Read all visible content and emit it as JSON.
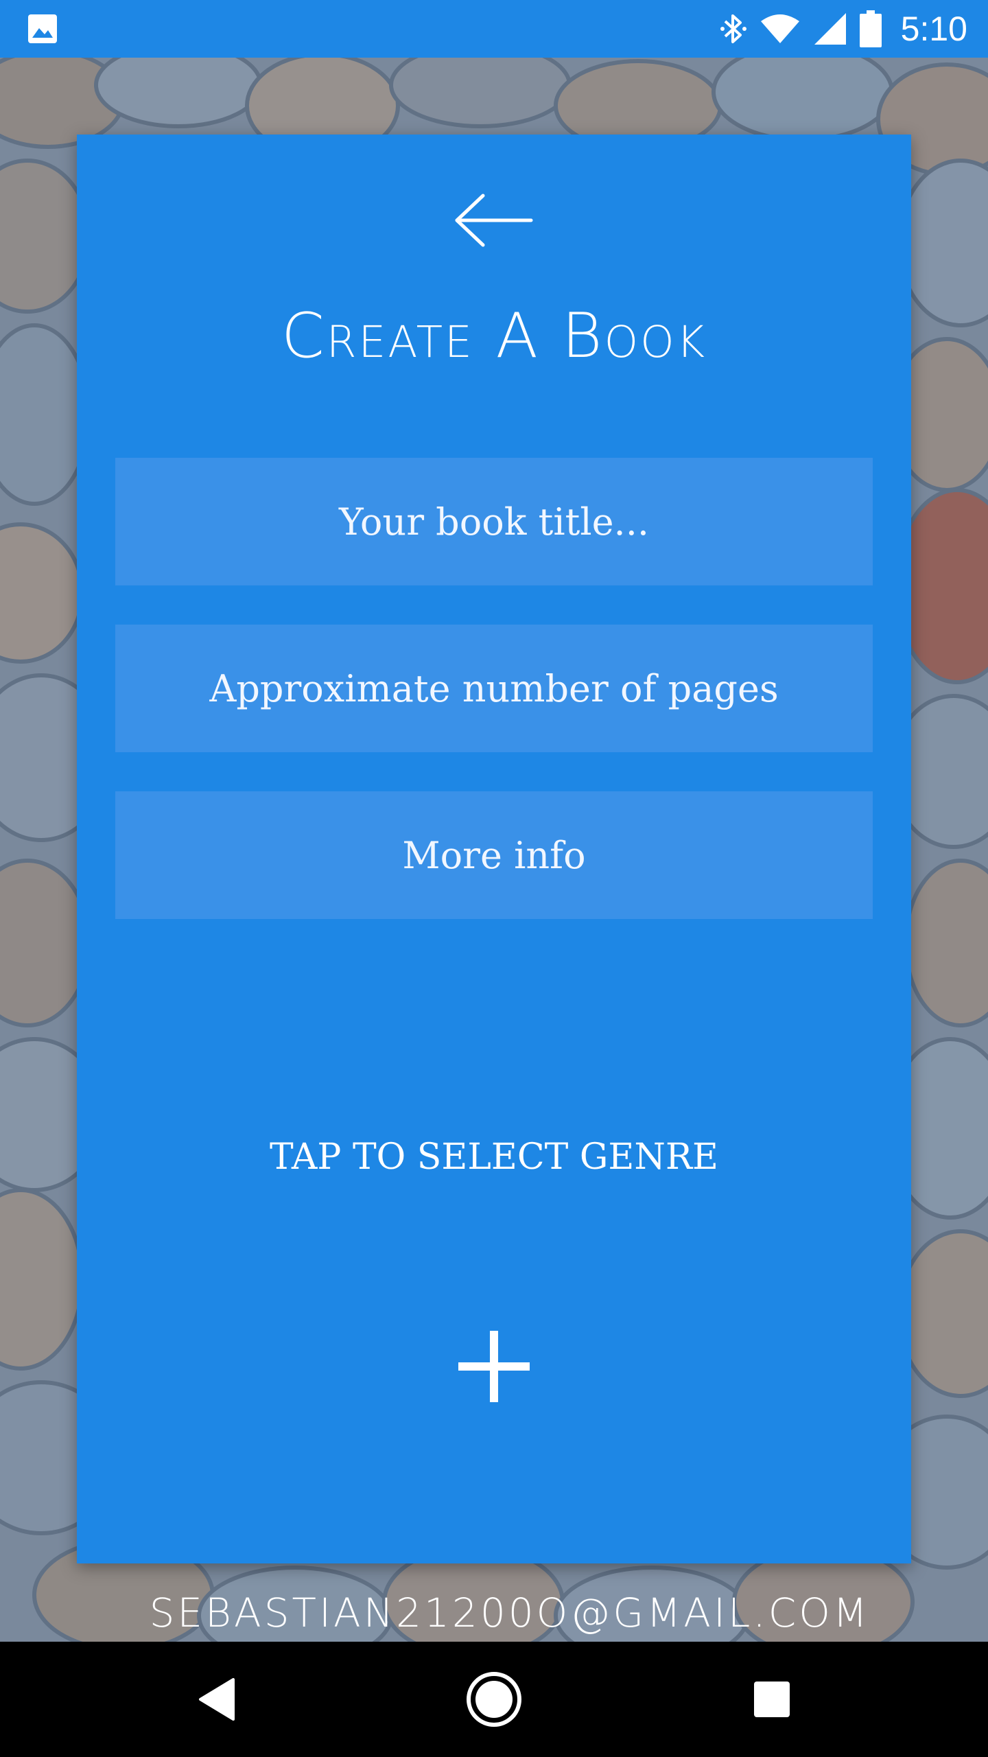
{
  "status_bar": {
    "time": "5:10",
    "icons": [
      "gallery-icon",
      "bluetooth-icon",
      "wifi-icon",
      "cell-signal-icon",
      "battery-icon"
    ]
  },
  "form": {
    "title": "Create A Book",
    "title_placeholder": "Your book title...",
    "pages_placeholder": "Approximate number of pages",
    "info_placeholder": "More info",
    "genre_label": "TAP TO SELECT GENRE",
    "user_email": "sebastian21200o@gmail.com"
  },
  "nav_bar": {
    "buttons": [
      "back-icon",
      "home-icon",
      "recents-icon"
    ]
  },
  "colors": {
    "accent": "#1e87e5",
    "field_background": "#3a91e8",
    "text": "#ffffff"
  }
}
